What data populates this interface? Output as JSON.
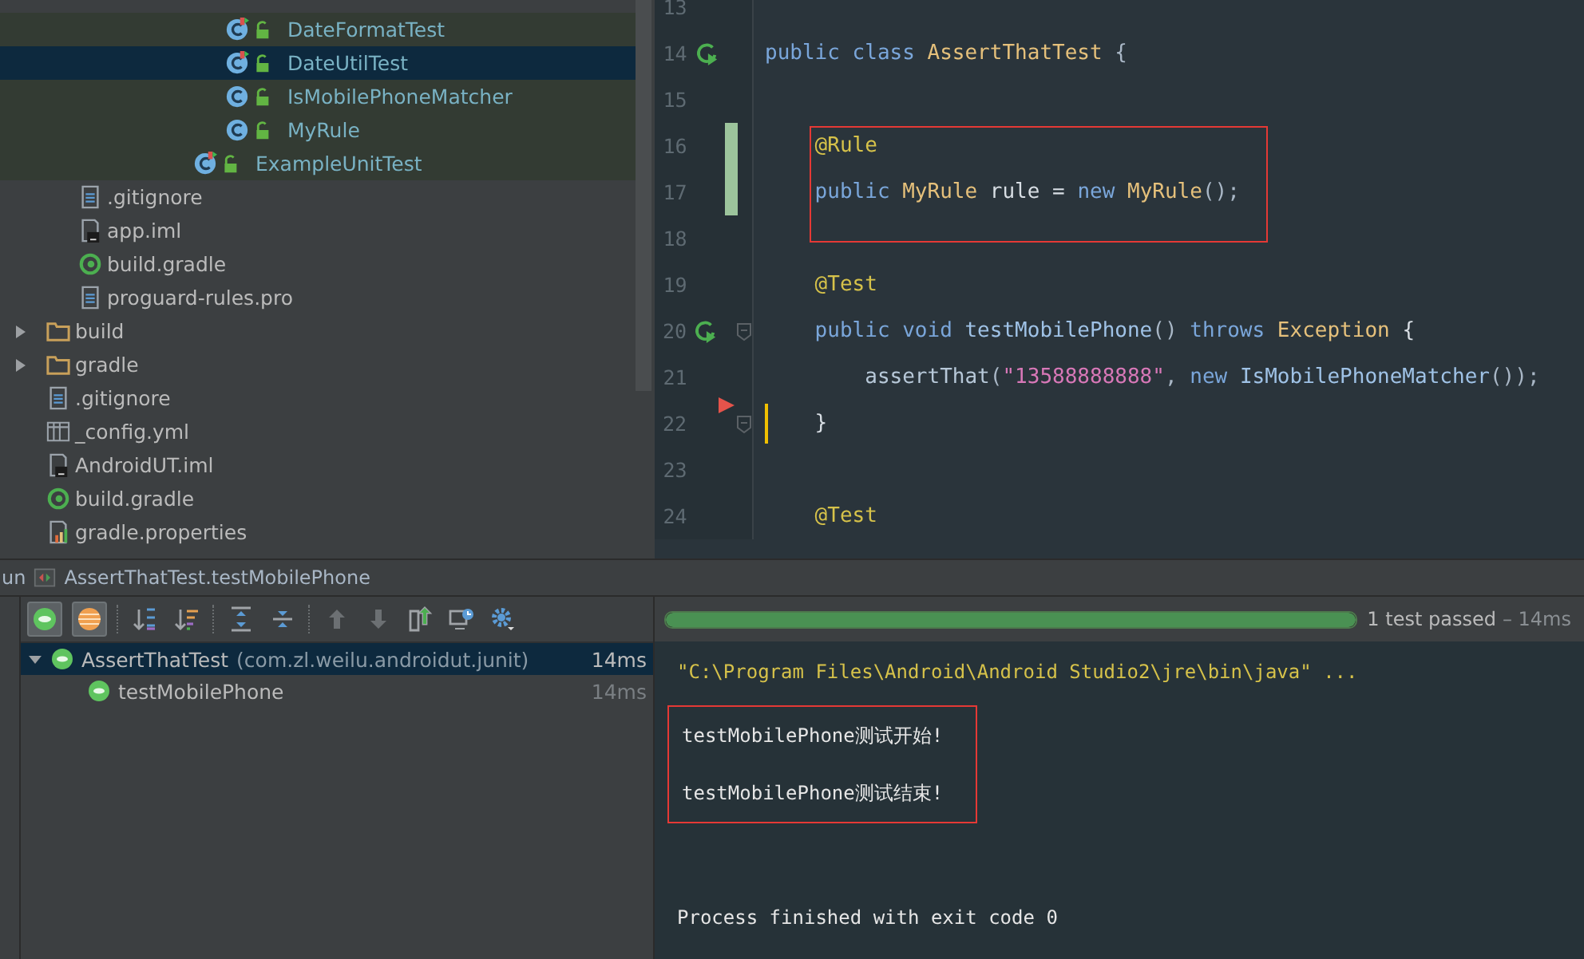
{
  "project_tree": {
    "items": [
      {
        "children": [
          {
            "children": [
              {
                "children": [
                  {
                    "children": [
                      {
                        "children": [
                          {
                            "children": [
                              {
                                "label": "DateFormatTest",
                                "kind": "test_class",
                                "selected": false
                              },
                              {
                                "label": "DateUtilTest",
                                "kind": "test_class",
                                "selected": true
                              },
                              {
                                "label": "IsMobilePhoneMatcher",
                                "kind": "class",
                                "selected": false
                              },
                              {
                                "label": "MyRule",
                                "kind": "class",
                                "selected": false
                              }
                            ]
                          },
                          {
                            "label": "ExampleUnitTest",
                            "kind": "test_class",
                            "selected": false
                          }
                        ]
                      }
                    ]
                  }
                ]
              }
            ]
          },
          {
            "label": ".gitignore",
            "kind": "text_file",
            "selected": false
          },
          {
            "label": "app.iml",
            "kind": "iml_file",
            "selected": false
          },
          {
            "label": "build.gradle",
            "kind": "gradle_file",
            "selected": false
          },
          {
            "label": "proguard-rules.pro",
            "kind": "text_file",
            "selected": false
          }
        ]
      },
      {
        "label": "build",
        "kind": "folder",
        "expanded": false,
        "selected": false
      },
      {
        "label": "gradle",
        "kind": "folder",
        "expanded": false,
        "selected": false
      },
      {
        "label": ".gitignore",
        "kind": "text_file",
        "selected": false
      },
      {
        "label": "_config.yml",
        "kind": "table_file",
        "selected": false
      },
      {
        "label": "AndroidUT.iml",
        "kind": "iml_file",
        "selected": false
      },
      {
        "label": "build.gradle",
        "kind": "gradle_file",
        "selected": false
      },
      {
        "label": "gradle.properties",
        "kind": "properties_file",
        "selected": false
      }
    ]
  },
  "editor": {
    "lines": [
      {
        "number": "13"
      },
      {
        "number": "14",
        "runnable": true,
        "tokens": [
          {
            "kind": "kw",
            "text": "public class "
          },
          {
            "kind": "type",
            "text": "AssertThatTest"
          },
          {
            "kind": "punct",
            "text": " {"
          }
        ]
      },
      {
        "number": "15"
      },
      {
        "number": "16",
        "changed": true,
        "boxed": true,
        "tokens": [
          {
            "kind": "ann",
            "text": "    @Rule"
          }
        ]
      },
      {
        "number": "17",
        "changed": true,
        "boxed": true,
        "tokens": [
          {
            "kind": "kw",
            "text": "    public "
          },
          {
            "kind": "type",
            "text": "MyRule "
          },
          {
            "kind": "ident",
            "text": "rule = "
          },
          {
            "kind": "kw",
            "text": "new "
          },
          {
            "kind": "type",
            "text": "MyRule"
          },
          {
            "kind": "punct",
            "text": "();"
          }
        ]
      },
      {
        "number": "18",
        "boxed": true
      },
      {
        "number": "19",
        "tokens": [
          {
            "kind": "ann",
            "text": "    @Test"
          }
        ]
      },
      {
        "number": "20",
        "runnable": true,
        "fold": true,
        "tokens": [
          {
            "kind": "kw",
            "text": "    public void "
          },
          {
            "kind": "method",
            "text": "testMobilePhone"
          },
          {
            "kind": "punct",
            "text": "() "
          },
          {
            "kind": "kw",
            "text": "throws "
          },
          {
            "kind": "type",
            "text": "Exception "
          },
          {
            "kind": "ident",
            "text": "{"
          }
        ]
      },
      {
        "number": "21",
        "tokens": [
          {
            "kind": "call",
            "text": "        assertThat"
          },
          {
            "kind": "punct",
            "text": "("
          },
          {
            "kind": "str",
            "text": "\"13588888888\""
          },
          {
            "kind": "punct",
            "text": ", "
          },
          {
            "kind": "kw",
            "text": "new "
          },
          {
            "kind": "method",
            "text": "IsMobilePhoneMatcher"
          },
          {
            "kind": "punct",
            "text": "());"
          }
        ]
      },
      {
        "number": "22",
        "fold": true,
        "marker": true,
        "caret": true,
        "tokens": [
          {
            "kind": "ident",
            "text": "    }"
          }
        ]
      },
      {
        "number": "23"
      },
      {
        "number": "24",
        "tokens": [
          {
            "kind": "ann",
            "text": "    @Test"
          }
        ]
      }
    ]
  },
  "run_bar": {
    "tab_cut": "un",
    "title": "AssertThatTest.testMobilePhone"
  },
  "toolbar": [
    {
      "kind": "show_passed",
      "selected": true
    },
    {
      "kind": "show_ignored",
      "selected": true
    },
    {
      "kind": "sort_alpha"
    },
    {
      "kind": "sort_duration"
    },
    {
      "kind": "expand_all"
    },
    {
      "kind": "collapse_all"
    },
    {
      "kind": "up"
    },
    {
      "kind": "down"
    },
    {
      "kind": "export"
    },
    {
      "kind": "history"
    },
    {
      "kind": "settings"
    }
  ],
  "test_tree": [
    {
      "name": "AssertThatTest",
      "package": "(com.zl.weilu.androidut.junit)",
      "time": "14ms",
      "passed": true,
      "expanded": true,
      "selected": true,
      "children": [
        {
          "name": "testMobilePhone",
          "time": "14ms",
          "passed": true,
          "selected": false
        }
      ]
    }
  ],
  "progress": {
    "level": 1,
    "summary": "1 test passed",
    "duration": "– 14ms"
  },
  "console": [
    {
      "kind": "command",
      "text": "\"C:\\Program Files\\Android\\Android Studio2\\jre\\bin\\java\" ..."
    },
    {
      "kind": "output",
      "text": "testMobilePhone测试开始!",
      "boxed": true
    },
    {
      "kind": "output",
      "text": "testMobilePhone测试结束!",
      "boxed": true
    },
    {
      "kind": "exit",
      "text": "Process finished with exit code 0"
    }
  ]
}
